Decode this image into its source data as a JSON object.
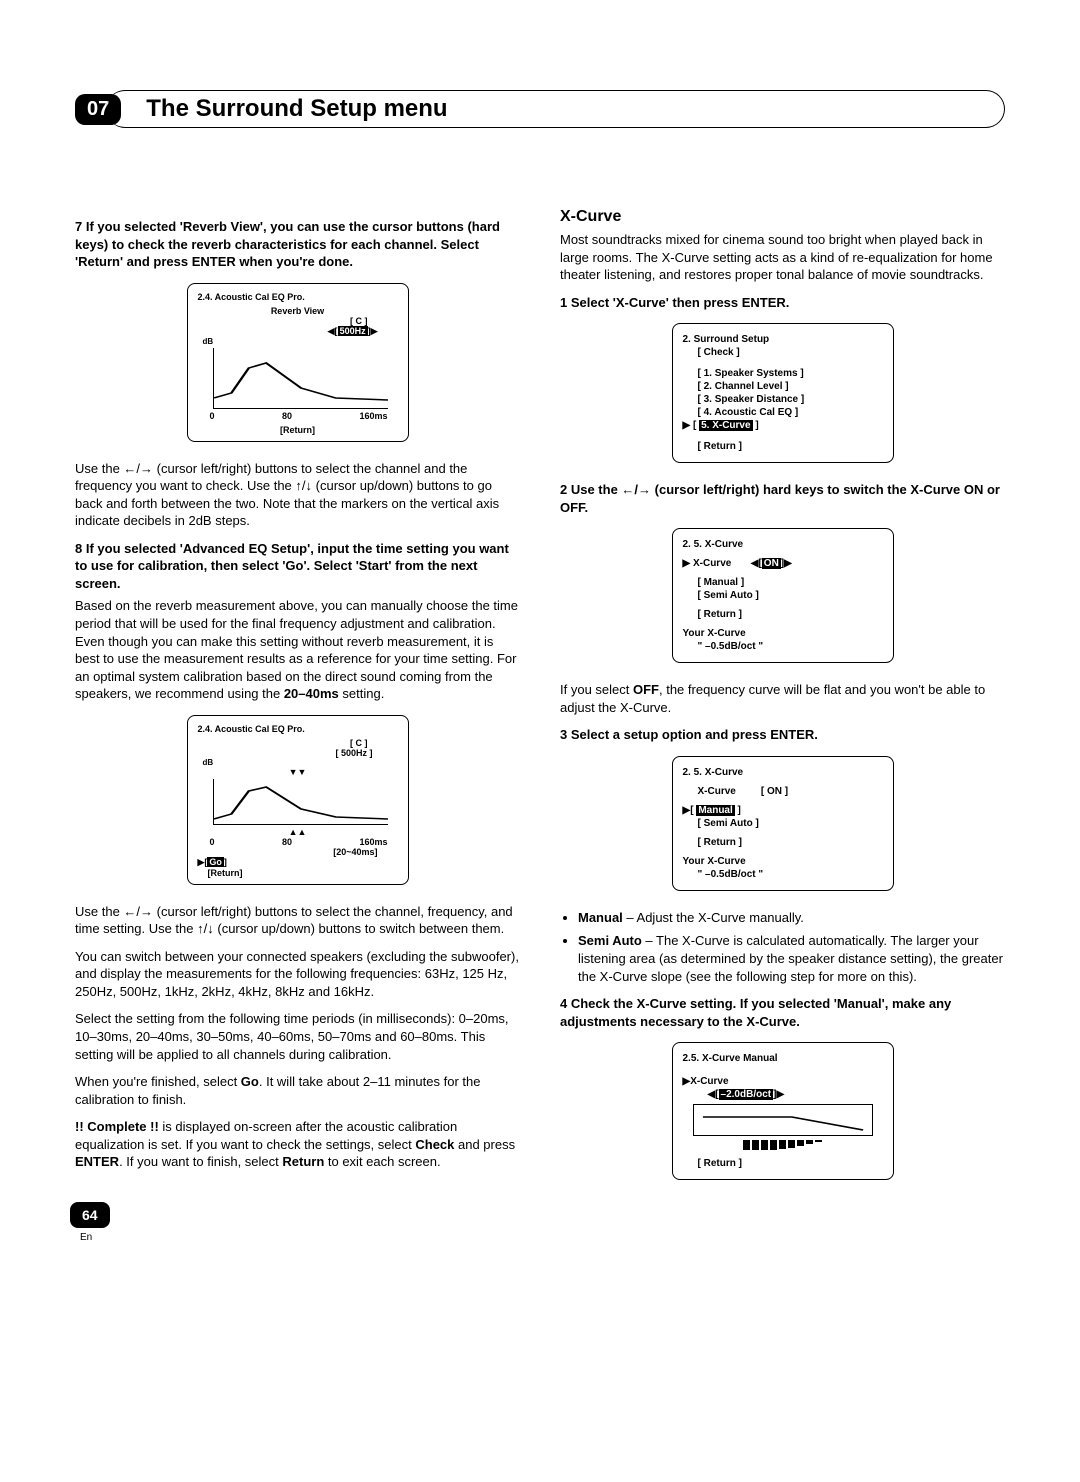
{
  "header": {
    "chapter_number": "07",
    "chapter_title": "The Surround Setup menu"
  },
  "left_col": {
    "step7_heading": "7   If you selected 'Reverb View', you can use the cursor buttons (hard keys) to check the reverb characteristics for each channel. Select 'Return' and press ENTER when you're done.",
    "osd1": {
      "title": "2.4. Acoustic Cal EQ Pro.",
      "subtitle": "Reverb View",
      "channel": "[  C  ]",
      "freq_hl": "500Hz",
      "x_mid": "80",
      "x_end": "160ms",
      "return": "[Return]"
    },
    "p1a": "Use the ",
    "p1b": " (cursor left/right) buttons to select the channel and the frequency you want to check. Use the ",
    "p1c": " (cursor up/down) buttons to go back and forth between the two. Note that the markers on the vertical axis indicate decibels in 2dB steps.",
    "step8_heading": "8   If you selected 'Advanced EQ Setup', input the time setting you want to use for calibration, then select 'Go'. Select 'Start' from the next screen.",
    "p2a": "Based on the reverb measurement above, you can manually choose the time period that will be used for the final frequency adjustment and calibration. Even though you can make this setting without reverb measurement, it is best to use the measurement results as a reference for your time setting. For an optimal system calibration based on the direct sound coming from the speakers, we recommend using the ",
    "p2b_bold": "20–40ms",
    "p2c": " setting.",
    "osd2": {
      "title": "2.4. Acoustic Cal EQ Pro.",
      "channel": "[  C  ]",
      "freq": "[ 500Hz ]",
      "x_mid": "80",
      "x_end": "160ms",
      "range": "[20~40ms]",
      "go_hl": "Go",
      "return": "[Return]"
    },
    "p3a": "Use the ",
    "p3b": " (cursor left/right) buttons to select the channel, frequency, and time setting. Use the ",
    "p3c": " (cursor up/down) buttons to switch between them.",
    "p4": "You can switch between your connected speakers (excluding the subwoofer), and display the measurements for the following frequencies: 63Hz, 125 Hz, 250Hz, 500Hz, 1kHz, 2kHz, 4kHz, 8kHz and 16kHz.",
    "p5": "Select the setting from the following time periods (in milliseconds): 0–20ms, 10–30ms, 20–40ms, 30–50ms, 40–60ms, 50–70ms and 60–80ms. This setting will be applied to all channels during calibration.",
    "p6a": "When you're finished, select ",
    "p6b_bold": "Go",
    "p6c": ". It will take about 2–11 minutes for the calibration to finish.",
    "p7a_bold": "!! Complete !!",
    "p7b": " is displayed on-screen after the acoustic calibration equalization is set. If you want to check the settings, select ",
    "p7c_bold": "Check",
    "p7d": " and press ",
    "p7e_bold": "ENTER",
    "p7f": ". If you want to finish, select ",
    "p7g_bold": "Return",
    "p7h": " to exit each screen."
  },
  "right_col": {
    "section_title": "X-Curve",
    "intro": "Most soundtracks mixed for cinema sound too bright when played back in large rooms. The X-Curve setting acts as a kind of re-equalization for home theater listening, and restores proper tonal balance of movie soundtracks.",
    "step1_heading": "1   Select 'X-Curve' then press ENTER.",
    "osd3": {
      "title": "2. Surround Setup",
      "check": "[ Check ]",
      "item1": "[ 1. Speaker Systems ]",
      "item2": "[ 2. Channel Level ]",
      "item3": "[ 3. Speaker Distance ]",
      "item4": "[ 4. Acoustic Cal EQ ]",
      "item5_pre": "[ ",
      "item5_hl": "5. X-Curve",
      "item5_post": " ]",
      "return": "[ Return ]"
    },
    "step2_heading_a": "2   Use the ",
    "step2_heading_b": " (cursor left/right) hard keys to switch the X-Curve ON or OFF.",
    "osd4": {
      "title": "2. 5. X-Curve",
      "row_label": "X-Curve",
      "row_val_hl": "ON",
      "manual": "[ Manual ]",
      "semi": "[ Semi Auto ]",
      "return": "[ Return ]",
      "your": "Your X-Curve",
      "val": "\"   –0.5dB/oct            \""
    },
    "p_off_a": "If you select ",
    "p_off_bold": "OFF",
    "p_off_b": ", the frequency curve will be flat and you won't be able to adjust the X-Curve.",
    "step3_heading": "3   Select a setup option and press ENTER.",
    "osd5": {
      "title": "2. 5. X-Curve",
      "row_label": "X-Curve",
      "row_val": "[ ON ]",
      "manual_pre": "[ ",
      "manual_hl": "Manual",
      "manual_post": " ]",
      "semi": "[ Semi Auto ]",
      "return": "[ Return ]",
      "your": "Your X-Curve",
      "val": "\"   –0.5dB/oct            \""
    },
    "bullet1_bold": "Manual",
    "bullet1_rest": " – Adjust the X-Curve manually.",
    "bullet2_bold": "Semi Auto",
    "bullet2_rest": " – The X-Curve is calculated automatically. The larger your listening area (as determined by the speaker distance setting), the greater the X-Curve slope (see the following step for more on this).",
    "step4_heading": "4   Check the X-Curve setting. If you selected 'Manual', make any adjustments necessary to the X-Curve.",
    "osd6": {
      "title": "2.5. X-Curve  Manual",
      "row_label": "X-Curve",
      "row_val_hl": "–2.0dB/oct",
      "return": "[ Return ]"
    }
  },
  "footer": {
    "page_number": "64",
    "lang": "En"
  }
}
